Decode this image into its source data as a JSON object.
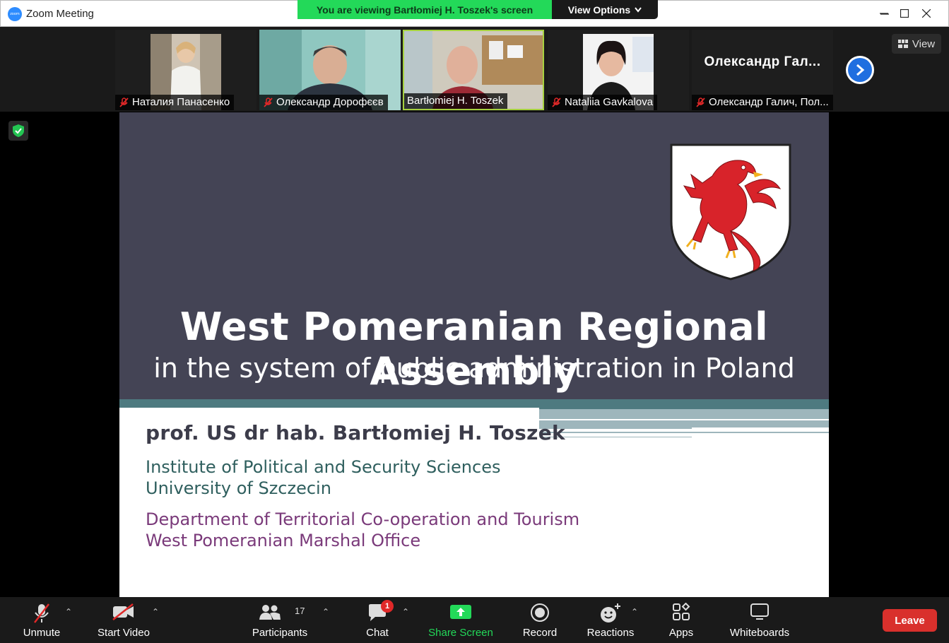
{
  "window": {
    "title": "Zoom Meeting",
    "app_icon_text": "zoom"
  },
  "banner": {
    "viewing_text": "You are viewing Bartłomiej H. Toszek's screen",
    "view_options_label": "View Options"
  },
  "participants_strip": {
    "tiles": [
      {
        "name": "Наталия Панасенко",
        "muted": true,
        "has_video": true
      },
      {
        "name": "Олександр Дорофєєв",
        "muted": true,
        "has_video": true
      },
      {
        "name": "Bartłomiej H. Toszek",
        "muted": false,
        "has_video": true,
        "active_speaker": true
      },
      {
        "name": "Nataliia Gavkalova",
        "muted": true,
        "has_video": true
      },
      {
        "name": "Олександр Галич, Пол...",
        "display_name_large": "Олександр Гал...",
        "muted": true,
        "has_video": false
      }
    ],
    "view_button_label": "View"
  },
  "slide": {
    "title": "West Pomeranian Regional Assembly",
    "subtitle": "in the system of public administration in Poland",
    "presenter": "prof. US dr hab. Bartłomiej H. Toszek",
    "affiliation_lines_green": [
      "Institute of Political and Security Sciences",
      "University of Szczecin"
    ],
    "affiliation_lines_purple": [
      "Department of Territorial Co-operation and Tourism",
      "West Pomeranian Marshal Office"
    ],
    "colors": {
      "header_bg": "#444455",
      "teal": "#4e7a80",
      "green_text": "#2f5f5e",
      "purple_text": "#7a3a7a",
      "griffin_red": "#d8232a"
    }
  },
  "toolbar": {
    "unmute_label": "Unmute",
    "start_video_label": "Start Video",
    "participants_label": "Participants",
    "participants_count": "17",
    "chat_label": "Chat",
    "chat_badge": "1",
    "share_screen_label": "Share Screen",
    "record_label": "Record",
    "reactions_label": "Reactions",
    "apps_label": "Apps",
    "whiteboards_label": "Whiteboards",
    "leave_label": "Leave"
  }
}
